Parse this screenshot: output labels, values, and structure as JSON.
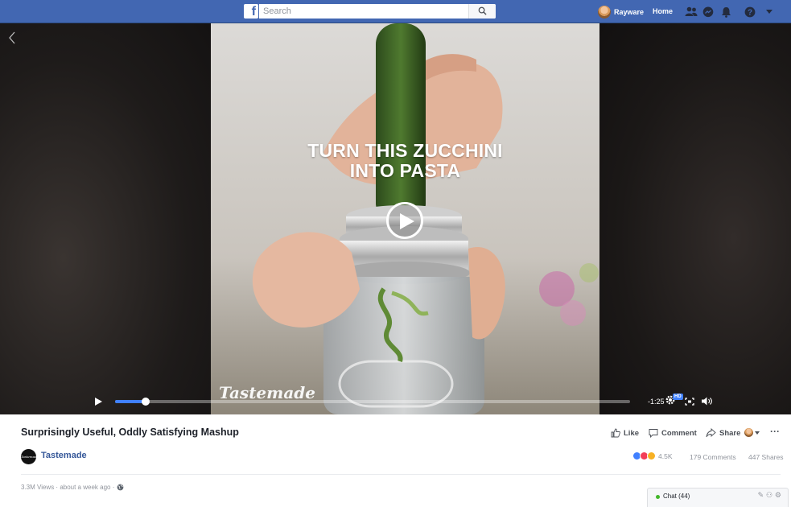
{
  "topbar": {
    "logo": "f",
    "search_placeholder": "Search",
    "user_name": "Rayware",
    "home_label": "Home",
    "icons": [
      "friend-requests-icon",
      "messenger-icon",
      "notifications-icon",
      "help-icon",
      "account-menu-icon"
    ]
  },
  "video": {
    "overlay_title_line1": "TURN THIS ZUCCHINI",
    "overlay_title_line2": "INTO PASTA",
    "watermark": "Tastemade",
    "time_remaining": "-1:25",
    "quality_badge": "HD",
    "progress": 0.06
  },
  "post": {
    "title": "Surprisingly Useful, Oddly Satisfying Mashup",
    "page_name": "Tastemade",
    "page_avatar_text": "Tastemade",
    "actions": {
      "like": "Like",
      "comment": "Comment",
      "share": "Share",
      "more": "···"
    },
    "reactions_count": "4.5K",
    "comments": "179 Comments",
    "shares": "447 Shares",
    "views": "3.3M Views · about a week ago ·"
  },
  "chat": {
    "label": "Chat (44)"
  },
  "colors": {
    "brand": "#4267b2",
    "link": "#365899",
    "progress": "#4080ff"
  }
}
